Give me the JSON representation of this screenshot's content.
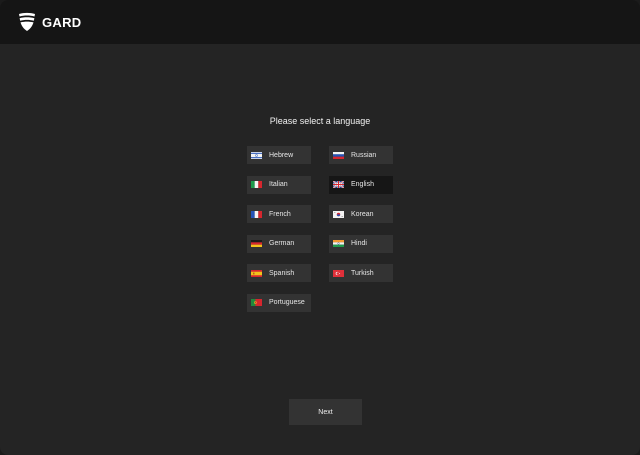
{
  "app": {
    "brand_name": "GARD",
    "logo_icon": "gard-shield-logo-icon"
  },
  "page": {
    "heading": "Please select a language",
    "selected_language": "English"
  },
  "languages": [
    {
      "label": "Hebrew",
      "flag_icon": "flag-israel-icon"
    },
    {
      "label": "Russian",
      "flag_icon": "flag-russia-icon"
    },
    {
      "label": "Italian",
      "flag_icon": "flag-italy-icon"
    },
    {
      "label": "English",
      "flag_icon": "flag-uk-icon"
    },
    {
      "label": "French",
      "flag_icon": "flag-france-icon"
    },
    {
      "label": "Korean",
      "flag_icon": "flag-south-korea-icon"
    },
    {
      "label": "German",
      "flag_icon": "flag-germany-icon"
    },
    {
      "label": "Hindi",
      "flag_icon": "flag-india-icon"
    },
    {
      "label": "Spanish",
      "flag_icon": "flag-spain-icon"
    },
    {
      "label": "Turkish",
      "flag_icon": "flag-turkey-icon"
    },
    {
      "label": "Portuguese",
      "flag_icon": "flag-portugal-icon"
    }
  ],
  "footer": {
    "next_label": "Next"
  },
  "colors": {
    "background": "#242424",
    "topbar": "#151515",
    "button": "#333333",
    "button_selected": "#161616"
  }
}
